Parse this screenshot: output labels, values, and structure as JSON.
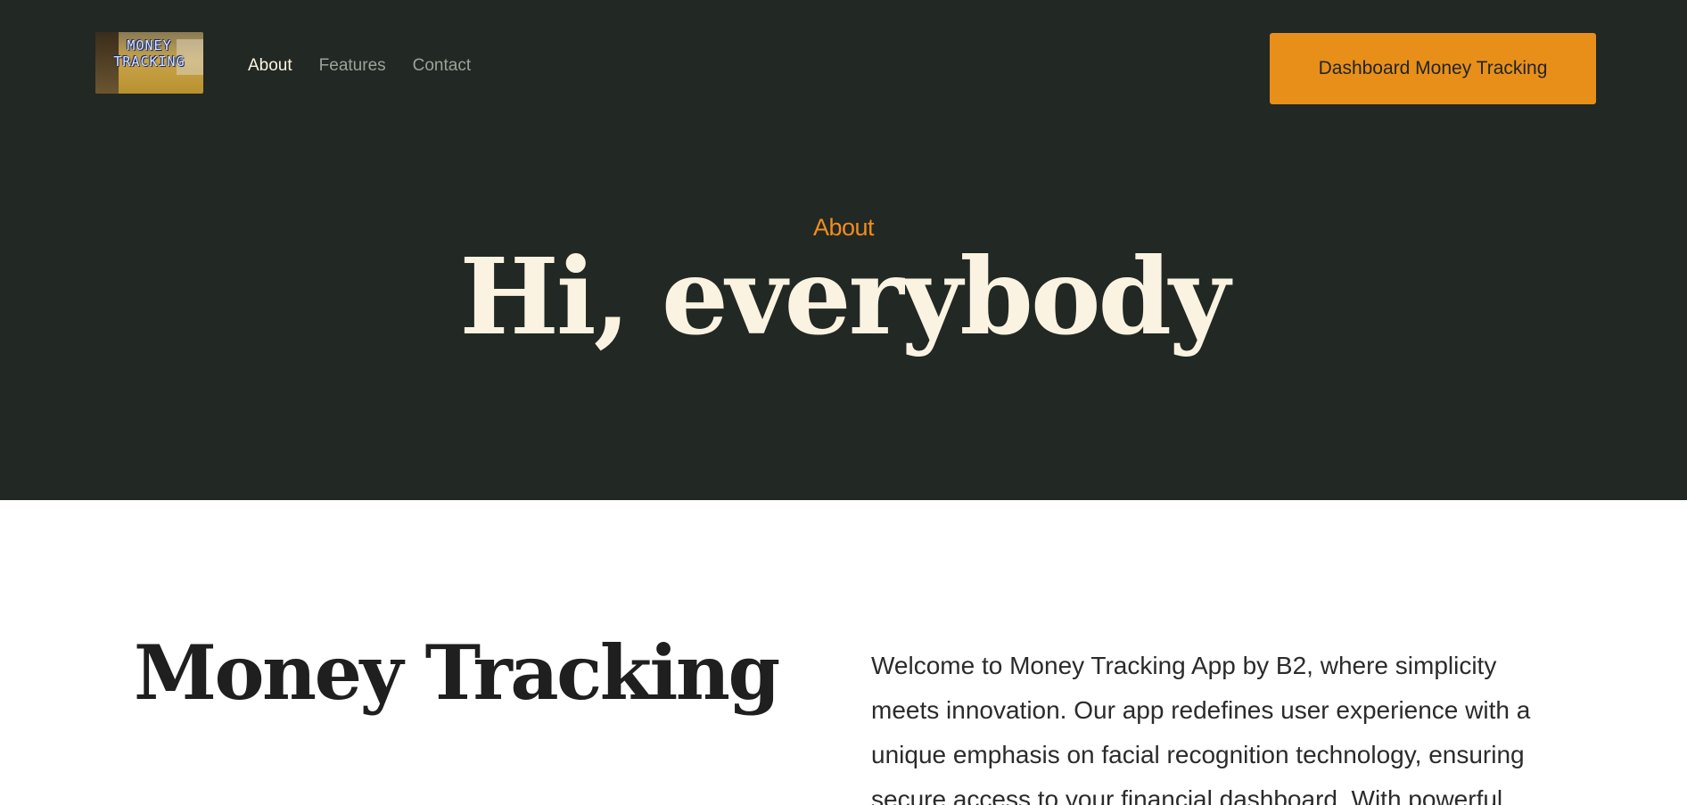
{
  "header": {
    "logo": {
      "lines": [
        "MONEY",
        "TRACKING"
      ],
      "icon": "money-tracking-logo"
    },
    "nav": [
      {
        "label": "About",
        "active": true
      },
      {
        "label": "Features",
        "active": false
      },
      {
        "label": "Contact",
        "active": false
      }
    ],
    "cta_label": "Dashboard Money Tracking"
  },
  "hero": {
    "eyebrow": "About",
    "title": "Hi, everybody"
  },
  "main": {
    "title": "Money Tracking",
    "intro": "Welcome to Money Tracking App by B2, where simplicity meets innovation. Our app redefines user experience with a unique emphasis on facial recognition technology, ensuring secure access to your financial dashboard. With powerful"
  },
  "colors": {
    "hero_bg": "#222823",
    "accent": "#e88f1a",
    "eyebrow": "#f08c1e",
    "hero_text": "#fbf3e2",
    "nav_inactive": "#9aa39a"
  }
}
